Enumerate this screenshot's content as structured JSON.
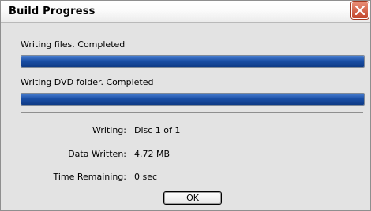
{
  "window": {
    "title": "Build Progress"
  },
  "tasks": [
    {
      "label": "Writing files. Completed",
      "progress": 1.0
    },
    {
      "label": "Writing DVD folder. Completed",
      "progress": 1.0
    }
  ],
  "details": [
    {
      "key": "Writing:",
      "value": "Disc 1 of 1"
    },
    {
      "key": "Data Written:",
      "value": "4.72 MB"
    },
    {
      "key": "Time Remaining:",
      "value": "0 sec"
    }
  ],
  "buttons": {
    "ok": "OK"
  },
  "colors": {
    "progress_fill": "#1a4fa6",
    "close_button": "#c2452a"
  },
  "icons": {
    "close": "close-x-icon"
  }
}
